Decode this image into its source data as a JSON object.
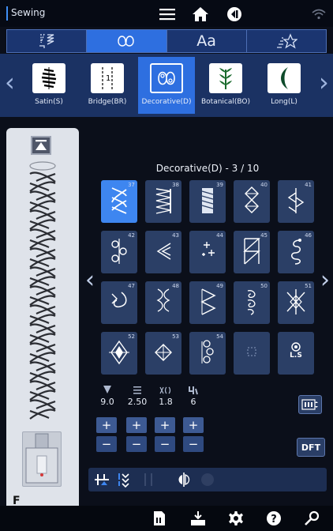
{
  "top_bar": {
    "mode_label": "Sewing",
    "icons": [
      "menu-icon",
      "home-icon",
      "back-icon",
      "wifi-icon"
    ]
  },
  "category_tabs": [
    {
      "name": "utility-stitches",
      "icon": "utility-stitch-icon",
      "active": false
    },
    {
      "name": "decorative-stitches",
      "icon": "decorative-stitch-icon",
      "active": true
    },
    {
      "name": "alphabet",
      "label": "Aa",
      "active": false
    },
    {
      "name": "my-stitches",
      "icon": "my-stitch-icon",
      "active": false
    }
  ],
  "sub_categories": [
    {
      "label": "Satin(S)",
      "active": false
    },
    {
      "label": "Bridge(BR)",
      "active": false
    },
    {
      "label": "Decorative(D)",
      "active": true
    },
    {
      "label": "Botanical(BO)",
      "active": false
    },
    {
      "label": "Long(L)",
      "active": false
    }
  ],
  "grid": {
    "title": "Decorative(D) - 3 / 10",
    "cells": [
      {
        "num": "37",
        "icon": "braid-stitch-icon",
        "selected": true
      },
      {
        "num": "38",
        "icon": "zigzag-band-stitch-icon"
      },
      {
        "num": "39",
        "icon": "satin-diagonal-stitch-icon"
      },
      {
        "num": "40",
        "icon": "diamond-chain-stitch-icon"
      },
      {
        "num": "41",
        "icon": "arrow-feather-stitch-icon"
      },
      {
        "num": "42",
        "icon": "scroll-stitch-icon"
      },
      {
        "num": "43",
        "icon": "arrow-left-stitch-icon"
      },
      {
        "num": "44",
        "icon": "sparkle-stitch-icon"
      },
      {
        "num": "45",
        "icon": "triangle-column-stitch-icon"
      },
      {
        "num": "46",
        "icon": "s-curl-stitch-icon"
      },
      {
        "num": "47",
        "icon": "curl-arrow-stitch-icon"
      },
      {
        "num": "48",
        "icon": "double-scroll-stitch-icon"
      },
      {
        "num": "49",
        "icon": "zigzag-triangle-stitch-icon"
      },
      {
        "num": "50",
        "icon": "spiral-stitch-icon"
      },
      {
        "num": "51",
        "icon": "cross-diamond-stitch-icon"
      },
      {
        "num": "52",
        "icon": "diamond-point-stitch-icon"
      },
      {
        "num": "53",
        "icon": "lozenge-stitch-icon"
      },
      {
        "num": "54",
        "icon": "triple-curl-stitch-icon"
      },
      {
        "num": "",
        "icon": "empty-slot-icon"
      },
      {
        "num": "",
        "icon": "ls-stitch-icon",
        "label": "L.S"
      }
    ]
  },
  "settings": [
    {
      "name": "stitch-width",
      "icon": "width-icon",
      "value": "9.0"
    },
    {
      "name": "stitch-length",
      "icon": "length-icon",
      "value": "2.50"
    },
    {
      "name": "stitch-density",
      "icon": "density-icon",
      "value": "1.8"
    },
    {
      "name": "tension",
      "icon": "tension-icon",
      "value": "6"
    }
  ],
  "buttons": {
    "plus": "+",
    "minus": "−",
    "dft": "DFT"
  },
  "preview": {
    "foot_label": "F"
  },
  "bottom_bar": {
    "icons": [
      "memory-icon",
      "download-icon",
      "settings-icon",
      "help-icon",
      "wrench-icon"
    ]
  },
  "colors": {
    "accent": "#2e6fe0",
    "cell": "#2b3f66",
    "panel": "#1b3263"
  }
}
